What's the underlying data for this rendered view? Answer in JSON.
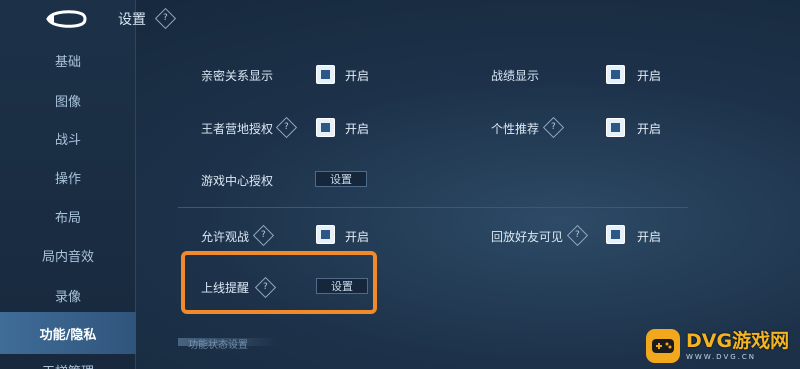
{
  "header": {
    "title": "设置"
  },
  "sidebar": {
    "items": [
      {
        "label": "基础",
        "active": false
      },
      {
        "label": "图像",
        "active": false
      },
      {
        "label": "战斗",
        "active": false
      },
      {
        "label": "操作",
        "active": false
      },
      {
        "label": "布局",
        "active": false
      },
      {
        "label": "局内音效",
        "active": false
      },
      {
        "label": "录像",
        "active": false
      },
      {
        "label": "功能/隐私",
        "active": true
      },
      {
        "label": "天梯管理",
        "active": false
      }
    ]
  },
  "settings": {
    "intimacy_display": {
      "label": "亲密关系显示",
      "checked": true,
      "state_label": "开启"
    },
    "record_display": {
      "label": "战绩显示",
      "checked": true,
      "state_label": "开启"
    },
    "camp_auth": {
      "label": "王者营地授权",
      "checked": true,
      "state_label": "开启",
      "help_icon": "question-icon"
    },
    "personal_recommend": {
      "label": "个性推荐",
      "checked": true,
      "state_label": "开启",
      "help_icon": "question-icon"
    },
    "game_center_auth": {
      "label": "游戏中心授权",
      "button_label": "设置"
    },
    "allow_spectate": {
      "label": "允许观战",
      "checked": true,
      "state_label": "开启",
      "help_icon": "question-icon"
    },
    "replay_friends_visible": {
      "label": "回放好友可见",
      "checked": true,
      "state_label": "开启",
      "help_icon": "question-icon"
    },
    "online_reminder": {
      "label": "上线提醒",
      "button_label": "设置",
      "help_icon": "question-icon"
    },
    "next_section_partial": "功能状态设置"
  },
  "colors": {
    "highlight": "#f08a2a",
    "active_nav": "#3f6c98",
    "checkbox_fill": "#2d5785",
    "watermark": "#f4b422"
  },
  "watermark": {
    "main": "DVG游戏网",
    "sub": "WWW.DVG.CN"
  }
}
